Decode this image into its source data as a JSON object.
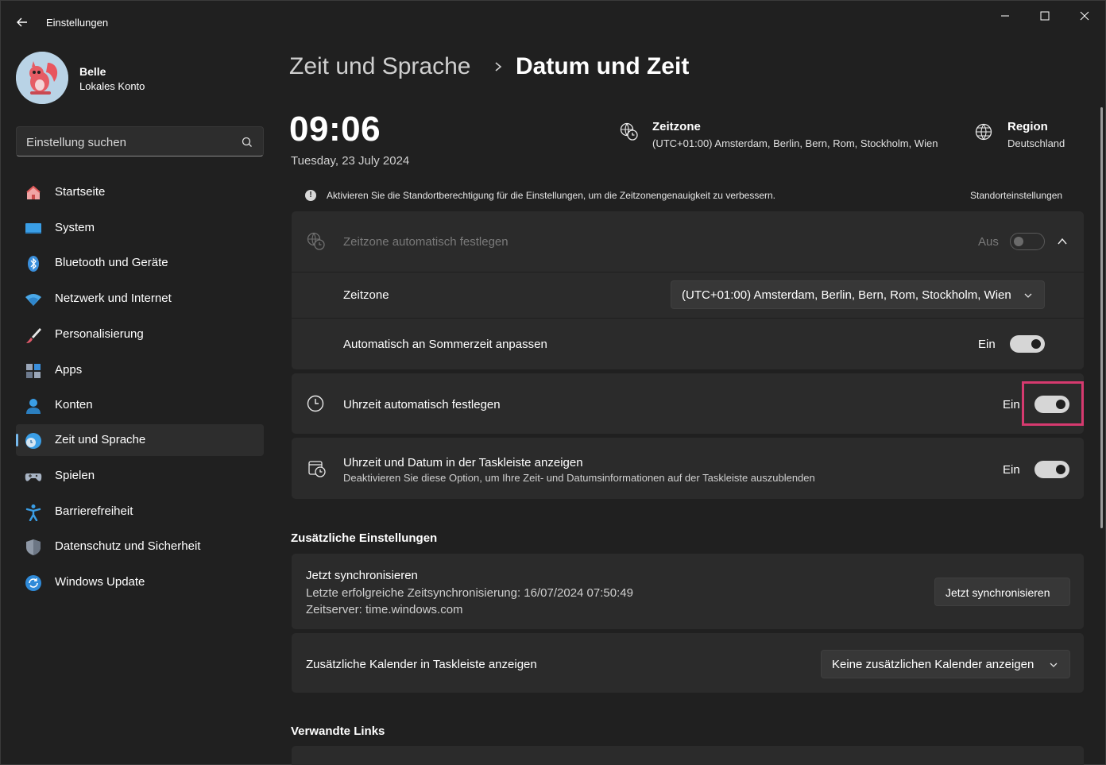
{
  "window": {
    "title": "Einstellungen",
    "controls": [
      "minimize",
      "maximize",
      "close"
    ]
  },
  "user": {
    "name": "Belle",
    "account_type": "Lokales Konto"
  },
  "search": {
    "placeholder": "Einstellung suchen"
  },
  "sidebar": {
    "items": [
      {
        "label": "Startseite",
        "icon": "home-icon"
      },
      {
        "label": "System",
        "icon": "display-icon"
      },
      {
        "label": "Bluetooth und Geräte",
        "icon": "bluetooth-icon"
      },
      {
        "label": "Netzwerk und Internet",
        "icon": "wifi-icon"
      },
      {
        "label": "Personalisierung",
        "icon": "brush-icon"
      },
      {
        "label": "Apps",
        "icon": "apps-icon"
      },
      {
        "label": "Konten",
        "icon": "person-icon"
      },
      {
        "label": "Zeit und Sprache",
        "icon": "time-language-icon",
        "active": true
      },
      {
        "label": "Spielen",
        "icon": "gamepad-icon"
      },
      {
        "label": "Barrierefreiheit",
        "icon": "accessibility-icon"
      },
      {
        "label": "Datenschutz und Sicherheit",
        "icon": "shield-icon"
      },
      {
        "label": "Windows Update",
        "icon": "update-icon"
      }
    ]
  },
  "breadcrumb": {
    "parent": "Zeit und Sprache",
    "current": "Datum und Zeit"
  },
  "clock": {
    "time": "09:06",
    "date": "Tuesday, 23 July 2024"
  },
  "timezone_summary": {
    "title": "Zeitzone",
    "value": "(UTC+01:00) Amsterdam, Berlin, Bern, Rom, Stockholm, Wien"
  },
  "region_summary": {
    "title": "Region",
    "value": "Deutschland"
  },
  "info_banner": {
    "icon": "!",
    "text": "Aktivieren Sie die Standortberechtigung für die Einstellungen, um die Zeitzonengenauigkeit zu verbessern.",
    "link": "Standorteinstellungen"
  },
  "settings": {
    "auto_timezone": {
      "label": "Zeitzone automatisch festlegen",
      "state": "Aus",
      "on": false,
      "disabled": true
    },
    "timezone": {
      "label": "Zeitzone",
      "value": "(UTC+01:00) Amsterdam, Berlin, Bern, Rom, Stockholm, Wien"
    },
    "dst": {
      "label": "Automatisch an Sommerzeit anpassen",
      "state": "Ein",
      "on": true
    },
    "auto_time": {
      "label": "Uhrzeit automatisch festlegen",
      "state": "Ein",
      "on": true
    },
    "taskbar_time": {
      "label": "Uhrzeit und Datum in der Taskleiste anzeigen",
      "description": "Deaktivieren Sie diese Option, um Ihre Zeit- und Datumsinformationen auf der Taskleiste auszublenden",
      "state": "Ein",
      "on": true
    }
  },
  "additional": {
    "title": "Zusätzliche Einstellungen",
    "sync": {
      "label": "Jetzt synchronisieren",
      "last_sync": "Letzte erfolgreiche Zeitsynchronisierung: 16/07/2024 07:50:49",
      "server": "Zeitserver: time.windows.com",
      "button": "Jetzt synchronisieren"
    },
    "calendar": {
      "label": "Zusätzliche Kalender in Taskleiste anzeigen",
      "value": "Keine zusätzlichen Kalender anzeigen"
    }
  },
  "related": {
    "title": "Verwandte Links"
  },
  "colors": {
    "background": "#202020",
    "card": "#2b2b2b",
    "accent": "#76b9ed",
    "highlight": "#d63a6f"
  }
}
